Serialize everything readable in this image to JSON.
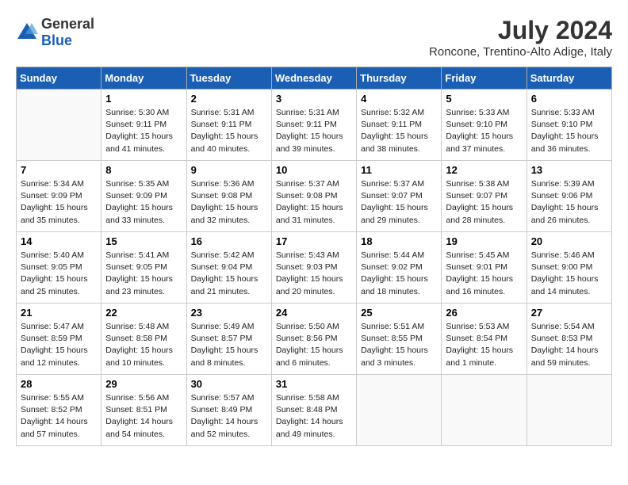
{
  "header": {
    "logo_line1": "General",
    "logo_line2": "Blue",
    "month_year": "July 2024",
    "location": "Roncone, Trentino-Alto Adige, Italy"
  },
  "weekdays": [
    "Sunday",
    "Monday",
    "Tuesday",
    "Wednesday",
    "Thursday",
    "Friday",
    "Saturday"
  ],
  "weeks": [
    [
      {
        "num": "",
        "info": ""
      },
      {
        "num": "1",
        "info": "Sunrise: 5:30 AM\nSunset: 9:11 PM\nDaylight: 15 hours\nand 41 minutes."
      },
      {
        "num": "2",
        "info": "Sunrise: 5:31 AM\nSunset: 9:11 PM\nDaylight: 15 hours\nand 40 minutes."
      },
      {
        "num": "3",
        "info": "Sunrise: 5:31 AM\nSunset: 9:11 PM\nDaylight: 15 hours\nand 39 minutes."
      },
      {
        "num": "4",
        "info": "Sunrise: 5:32 AM\nSunset: 9:11 PM\nDaylight: 15 hours\nand 38 minutes."
      },
      {
        "num": "5",
        "info": "Sunrise: 5:33 AM\nSunset: 9:10 PM\nDaylight: 15 hours\nand 37 minutes."
      },
      {
        "num": "6",
        "info": "Sunrise: 5:33 AM\nSunset: 9:10 PM\nDaylight: 15 hours\nand 36 minutes."
      }
    ],
    [
      {
        "num": "7",
        "info": "Sunrise: 5:34 AM\nSunset: 9:09 PM\nDaylight: 15 hours\nand 35 minutes."
      },
      {
        "num": "8",
        "info": "Sunrise: 5:35 AM\nSunset: 9:09 PM\nDaylight: 15 hours\nand 33 minutes."
      },
      {
        "num": "9",
        "info": "Sunrise: 5:36 AM\nSunset: 9:08 PM\nDaylight: 15 hours\nand 32 minutes."
      },
      {
        "num": "10",
        "info": "Sunrise: 5:37 AM\nSunset: 9:08 PM\nDaylight: 15 hours\nand 31 minutes."
      },
      {
        "num": "11",
        "info": "Sunrise: 5:37 AM\nSunset: 9:07 PM\nDaylight: 15 hours\nand 29 minutes."
      },
      {
        "num": "12",
        "info": "Sunrise: 5:38 AM\nSunset: 9:07 PM\nDaylight: 15 hours\nand 28 minutes."
      },
      {
        "num": "13",
        "info": "Sunrise: 5:39 AM\nSunset: 9:06 PM\nDaylight: 15 hours\nand 26 minutes."
      }
    ],
    [
      {
        "num": "14",
        "info": "Sunrise: 5:40 AM\nSunset: 9:05 PM\nDaylight: 15 hours\nand 25 minutes."
      },
      {
        "num": "15",
        "info": "Sunrise: 5:41 AM\nSunset: 9:05 PM\nDaylight: 15 hours\nand 23 minutes."
      },
      {
        "num": "16",
        "info": "Sunrise: 5:42 AM\nSunset: 9:04 PM\nDaylight: 15 hours\nand 21 minutes."
      },
      {
        "num": "17",
        "info": "Sunrise: 5:43 AM\nSunset: 9:03 PM\nDaylight: 15 hours\nand 20 minutes."
      },
      {
        "num": "18",
        "info": "Sunrise: 5:44 AM\nSunset: 9:02 PM\nDaylight: 15 hours\nand 18 minutes."
      },
      {
        "num": "19",
        "info": "Sunrise: 5:45 AM\nSunset: 9:01 PM\nDaylight: 15 hours\nand 16 minutes."
      },
      {
        "num": "20",
        "info": "Sunrise: 5:46 AM\nSunset: 9:00 PM\nDaylight: 15 hours\nand 14 minutes."
      }
    ],
    [
      {
        "num": "21",
        "info": "Sunrise: 5:47 AM\nSunset: 8:59 PM\nDaylight: 15 hours\nand 12 minutes."
      },
      {
        "num": "22",
        "info": "Sunrise: 5:48 AM\nSunset: 8:58 PM\nDaylight: 15 hours\nand 10 minutes."
      },
      {
        "num": "23",
        "info": "Sunrise: 5:49 AM\nSunset: 8:57 PM\nDaylight: 15 hours\nand 8 minutes."
      },
      {
        "num": "24",
        "info": "Sunrise: 5:50 AM\nSunset: 8:56 PM\nDaylight: 15 hours\nand 6 minutes."
      },
      {
        "num": "25",
        "info": "Sunrise: 5:51 AM\nSunset: 8:55 PM\nDaylight: 15 hours\nand 3 minutes."
      },
      {
        "num": "26",
        "info": "Sunrise: 5:53 AM\nSunset: 8:54 PM\nDaylight: 15 hours\nand 1 minute."
      },
      {
        "num": "27",
        "info": "Sunrise: 5:54 AM\nSunset: 8:53 PM\nDaylight: 14 hours\nand 59 minutes."
      }
    ],
    [
      {
        "num": "28",
        "info": "Sunrise: 5:55 AM\nSunset: 8:52 PM\nDaylight: 14 hours\nand 57 minutes."
      },
      {
        "num": "29",
        "info": "Sunrise: 5:56 AM\nSunset: 8:51 PM\nDaylight: 14 hours\nand 54 minutes."
      },
      {
        "num": "30",
        "info": "Sunrise: 5:57 AM\nSunset: 8:49 PM\nDaylight: 14 hours\nand 52 minutes."
      },
      {
        "num": "31",
        "info": "Sunrise: 5:58 AM\nSunset: 8:48 PM\nDaylight: 14 hours\nand 49 minutes."
      },
      {
        "num": "",
        "info": ""
      },
      {
        "num": "",
        "info": ""
      },
      {
        "num": "",
        "info": ""
      }
    ]
  ]
}
